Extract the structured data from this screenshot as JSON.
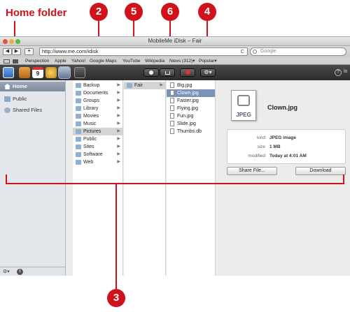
{
  "callouts": {
    "home_folder_label": "Home folder",
    "n2": "2",
    "n3": "3",
    "n4": "4",
    "n5": "5",
    "n6": "6",
    "color": "#d0121b"
  },
  "window": {
    "title": "MobileMe iDisk – Fair"
  },
  "browser": {
    "back": "◀",
    "forward": "▶",
    "add": "+",
    "url": "http://www.me.com/idisk",
    "reload": "C",
    "search_placeholder": "Google",
    "bookmarks": [
      "Perspection",
      "Apple",
      "Yahoo!",
      "Google Maps",
      "YouTube",
      "Wikipedia",
      "News (312)▾",
      "Popular▾"
    ]
  },
  "appbar": {
    "icons": [
      "mail-app-icon",
      "contacts-app-icon",
      "calendar-app-icon",
      "gallery-app-icon",
      "idisk-app-icon",
      "mobileme-app-icon"
    ],
    "calendar_day": "9",
    "help": "?",
    "user": "lo"
  },
  "sidebar": {
    "items": [
      {
        "label": "Home",
        "icon": "home-icon"
      },
      {
        "label": "Public",
        "icon": "folder-icon"
      },
      {
        "label": "Shared Files",
        "icon": "shared-icon"
      }
    ],
    "footer_gear": "⚙▾",
    "footer_info": "i"
  },
  "columns": {
    "col1": [
      "Backup",
      "Documents",
      "Groups",
      "Library",
      "Movies",
      "Music",
      "Pictures",
      "Public",
      "Sites",
      "Software",
      "Web"
    ],
    "col1_selected": "Pictures",
    "col2": [
      "Fair"
    ],
    "col3": [
      "Big.jpg",
      "Clown.jpg",
      "Faster.jpg",
      "Flying.jpg",
      "Fun.jpg",
      "Slide.jpg",
      "Thumbs.db"
    ],
    "col3_selected": "Clown.jpg"
  },
  "preview": {
    "icon_label": "JPEG",
    "filename": "Clown.jpg",
    "kind_label": "kind",
    "kind_value": "JPEG image",
    "size_label": "size",
    "size_value": "1 MB",
    "modified_label": "modified",
    "modified_value": "Today at 4:01 AM",
    "share_button": "Share File...",
    "download_button": "Download"
  }
}
